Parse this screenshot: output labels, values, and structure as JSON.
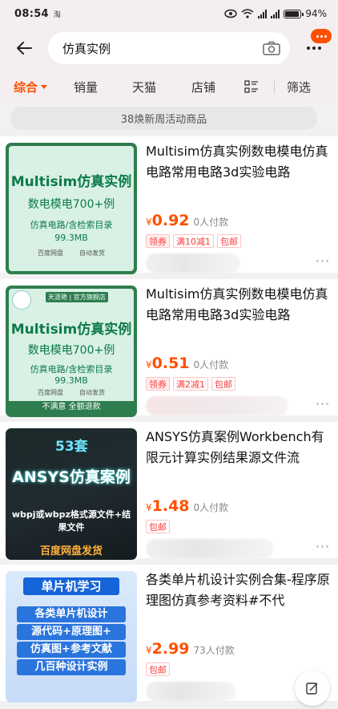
{
  "status_bar": {
    "time": "08:54",
    "app_indicator": "淘",
    "network_1": "4G",
    "network_2": "4G",
    "battery_text": "94%",
    "battery_level": 0.94
  },
  "search": {
    "query": "仿真实例"
  },
  "sort_tabs": [
    {
      "label": "综合",
      "active": true
    },
    {
      "label": "销量",
      "active": false
    },
    {
      "label": "天猫",
      "active": false
    },
    {
      "label": "店铺",
      "active": false
    },
    {
      "label": "筛选",
      "active": false
    }
  ],
  "campaign_banner": "38焕新周活动商品",
  "products": [
    {
      "title": "Multisim仿真实例数电模电仿真电路常用电路3d实验电路",
      "currency": "¥",
      "price": "0.92",
      "paid": "0人付款",
      "tags": [
        "领券",
        "满10减1",
        "包邮"
      ],
      "image": {
        "headline": "Multisim仿真实例",
        "line1": "数电模电700+例",
        "line2": "仿真电路/含检索目录",
        "line3": "99.3MB",
        "foot1": "百度网盘",
        "foot2": "自动发货"
      }
    },
    {
      "title": "Multisim仿真实例数电模电仿真电路常用电路3d实验电路",
      "currency": "¥",
      "price": "0.51",
      "paid": "0人付款",
      "tags": [
        "领券",
        "满2减1",
        "包邮"
      ],
      "image": {
        "shop": "天涯艳 | 官方旗舰店",
        "headline": "Multisim仿真实例",
        "line1": "数电模电700+例",
        "line2": "仿真电路/含检索目录",
        "line3": "99.3MB",
        "foot1": "百度网盘",
        "foot2": "自动发货",
        "guarantee": "不满意 全额退款"
      }
    },
    {
      "title": "ANSYS仿真案例Workbench有限元计算实例结果源文件流",
      "currency": "¥",
      "price": "1.48",
      "paid": "0人付款",
      "tags": [
        "包邮"
      ],
      "image": {
        "badge": "53套",
        "headline": "ANSYS仿真案例",
        "line1": "wbpj或wbpz格式源文件+结果文件",
        "foot": "百度网盘发货"
      }
    },
    {
      "title": "各类单片机设计实例合集-程序原理图仿真参考资料#不代",
      "currency": "¥",
      "price": "2.99",
      "paid": "73人付款",
      "tags": [
        "包邮"
      ],
      "image": {
        "headline": "单片机学习",
        "line1": "各类单片机设计",
        "line2": "源代码+原理图+",
        "line3": "仿真图+参考文献",
        "line4": "几百种设计实例"
      }
    }
  ],
  "colors": {
    "accent": "#ff5000",
    "header_bg": "#f4eef0",
    "tag_red": "#ff3b3b"
  },
  "icons": [
    "back-arrow-icon",
    "camera-icon",
    "more-icon",
    "list-view-icon",
    "edit-icon"
  ]
}
